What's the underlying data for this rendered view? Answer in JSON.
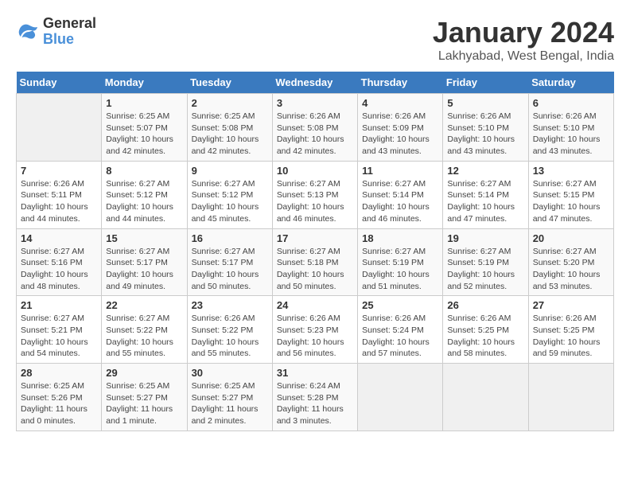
{
  "logo": {
    "line1": "General",
    "line2": "Blue"
  },
  "title": "January 2024",
  "subtitle": "Lakhyabad, West Bengal, India",
  "days_header": [
    "Sunday",
    "Monday",
    "Tuesday",
    "Wednesday",
    "Thursday",
    "Friday",
    "Saturday"
  ],
  "weeks": [
    [
      {
        "day": "",
        "info": ""
      },
      {
        "day": "1",
        "info": "Sunrise: 6:25 AM\nSunset: 5:07 PM\nDaylight: 10 hours\nand 42 minutes."
      },
      {
        "day": "2",
        "info": "Sunrise: 6:25 AM\nSunset: 5:08 PM\nDaylight: 10 hours\nand 42 minutes."
      },
      {
        "day": "3",
        "info": "Sunrise: 6:26 AM\nSunset: 5:08 PM\nDaylight: 10 hours\nand 42 minutes."
      },
      {
        "day": "4",
        "info": "Sunrise: 6:26 AM\nSunset: 5:09 PM\nDaylight: 10 hours\nand 43 minutes."
      },
      {
        "day": "5",
        "info": "Sunrise: 6:26 AM\nSunset: 5:10 PM\nDaylight: 10 hours\nand 43 minutes."
      },
      {
        "day": "6",
        "info": "Sunrise: 6:26 AM\nSunset: 5:10 PM\nDaylight: 10 hours\nand 43 minutes."
      }
    ],
    [
      {
        "day": "7",
        "info": "Sunrise: 6:26 AM\nSunset: 5:11 PM\nDaylight: 10 hours\nand 44 minutes."
      },
      {
        "day": "8",
        "info": "Sunrise: 6:27 AM\nSunset: 5:12 PM\nDaylight: 10 hours\nand 44 minutes."
      },
      {
        "day": "9",
        "info": "Sunrise: 6:27 AM\nSunset: 5:12 PM\nDaylight: 10 hours\nand 45 minutes."
      },
      {
        "day": "10",
        "info": "Sunrise: 6:27 AM\nSunset: 5:13 PM\nDaylight: 10 hours\nand 46 minutes."
      },
      {
        "day": "11",
        "info": "Sunrise: 6:27 AM\nSunset: 5:14 PM\nDaylight: 10 hours\nand 46 minutes."
      },
      {
        "day": "12",
        "info": "Sunrise: 6:27 AM\nSunset: 5:14 PM\nDaylight: 10 hours\nand 47 minutes."
      },
      {
        "day": "13",
        "info": "Sunrise: 6:27 AM\nSunset: 5:15 PM\nDaylight: 10 hours\nand 47 minutes."
      }
    ],
    [
      {
        "day": "14",
        "info": "Sunrise: 6:27 AM\nSunset: 5:16 PM\nDaylight: 10 hours\nand 48 minutes."
      },
      {
        "day": "15",
        "info": "Sunrise: 6:27 AM\nSunset: 5:17 PM\nDaylight: 10 hours\nand 49 minutes."
      },
      {
        "day": "16",
        "info": "Sunrise: 6:27 AM\nSunset: 5:17 PM\nDaylight: 10 hours\nand 50 minutes."
      },
      {
        "day": "17",
        "info": "Sunrise: 6:27 AM\nSunset: 5:18 PM\nDaylight: 10 hours\nand 50 minutes."
      },
      {
        "day": "18",
        "info": "Sunrise: 6:27 AM\nSunset: 5:19 PM\nDaylight: 10 hours\nand 51 minutes."
      },
      {
        "day": "19",
        "info": "Sunrise: 6:27 AM\nSunset: 5:19 PM\nDaylight: 10 hours\nand 52 minutes."
      },
      {
        "day": "20",
        "info": "Sunrise: 6:27 AM\nSunset: 5:20 PM\nDaylight: 10 hours\nand 53 minutes."
      }
    ],
    [
      {
        "day": "21",
        "info": "Sunrise: 6:27 AM\nSunset: 5:21 PM\nDaylight: 10 hours\nand 54 minutes."
      },
      {
        "day": "22",
        "info": "Sunrise: 6:27 AM\nSunset: 5:22 PM\nDaylight: 10 hours\nand 55 minutes."
      },
      {
        "day": "23",
        "info": "Sunrise: 6:26 AM\nSunset: 5:22 PM\nDaylight: 10 hours\nand 55 minutes."
      },
      {
        "day": "24",
        "info": "Sunrise: 6:26 AM\nSunset: 5:23 PM\nDaylight: 10 hours\nand 56 minutes."
      },
      {
        "day": "25",
        "info": "Sunrise: 6:26 AM\nSunset: 5:24 PM\nDaylight: 10 hours\nand 57 minutes."
      },
      {
        "day": "26",
        "info": "Sunrise: 6:26 AM\nSunset: 5:25 PM\nDaylight: 10 hours\nand 58 minutes."
      },
      {
        "day": "27",
        "info": "Sunrise: 6:26 AM\nSunset: 5:25 PM\nDaylight: 10 hours\nand 59 minutes."
      }
    ],
    [
      {
        "day": "28",
        "info": "Sunrise: 6:25 AM\nSunset: 5:26 PM\nDaylight: 11 hours\nand 0 minutes."
      },
      {
        "day": "29",
        "info": "Sunrise: 6:25 AM\nSunset: 5:27 PM\nDaylight: 11 hours\nand 1 minute."
      },
      {
        "day": "30",
        "info": "Sunrise: 6:25 AM\nSunset: 5:27 PM\nDaylight: 11 hours\nand 2 minutes."
      },
      {
        "day": "31",
        "info": "Sunrise: 6:24 AM\nSunset: 5:28 PM\nDaylight: 11 hours\nand 3 minutes."
      },
      {
        "day": "",
        "info": ""
      },
      {
        "day": "",
        "info": ""
      },
      {
        "day": "",
        "info": ""
      }
    ]
  ]
}
